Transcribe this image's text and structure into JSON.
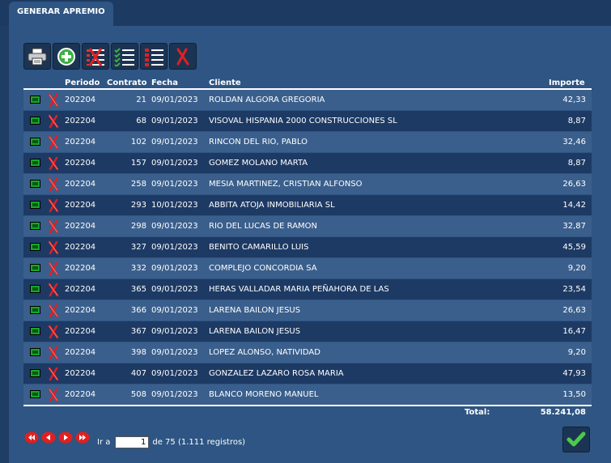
{
  "tab": {
    "title": "GENERAR APREMIO"
  },
  "toolbar": [
    {
      "icon": "printer-icon"
    },
    {
      "icon": "add-icon"
    },
    {
      "icon": "uncheck-all-icon"
    },
    {
      "icon": "check-list-icon"
    },
    {
      "icon": "numbered-list-icon"
    },
    {
      "icon": "delete-icon"
    }
  ],
  "table": {
    "headers": {
      "periodo": "Periodo",
      "contrato": "Contrato",
      "fecha": "Fecha",
      "cliente": "Cliente",
      "importe": "Importe"
    },
    "rows": [
      {
        "periodo": "202204",
        "contrato": "21",
        "fecha": "09/01/2023",
        "cliente": "ROLDAN ALGORA GREGORIA",
        "importe": "42,33"
      },
      {
        "periodo": "202204",
        "contrato": "68",
        "fecha": "09/01/2023",
        "cliente": "VISOVAL HISPANIA 2000 CONSTRUCCIONES SL",
        "importe": "8,87"
      },
      {
        "periodo": "202204",
        "contrato": "102",
        "fecha": "09/01/2023",
        "cliente": "RINCON DEL RIO, PABLO",
        "importe": "32,46"
      },
      {
        "periodo": "202204",
        "contrato": "157",
        "fecha": "09/01/2023",
        "cliente": "GOMEZ MOLANO MARTA",
        "importe": "8,87"
      },
      {
        "periodo": "202204",
        "contrato": "258",
        "fecha": "09/01/2023",
        "cliente": "MESIA MARTINEZ, CRISTIAN ALFONSO",
        "importe": "26,63"
      },
      {
        "periodo": "202204",
        "contrato": "293",
        "fecha": "10/01/2023",
        "cliente": "ABBITA ATOJA INMOBILIARIA SL",
        "importe": "14,42"
      },
      {
        "periodo": "202204",
        "contrato": "298",
        "fecha": "09/01/2023",
        "cliente": "RIO DEL LUCAS DE RAMON",
        "importe": "32,87"
      },
      {
        "periodo": "202204",
        "contrato": "327",
        "fecha": "09/01/2023",
        "cliente": "BENITO CAMARILLO LUIS",
        "importe": "45,59"
      },
      {
        "periodo": "202204",
        "contrato": "332",
        "fecha": "09/01/2023",
        "cliente": "COMPLEJO CONCORDIA SA",
        "importe": "9,20"
      },
      {
        "periodo": "202204",
        "contrato": "365",
        "fecha": "09/01/2023",
        "cliente": "HERAS VALLADAR MARIA PEÑAHORA DE LAS",
        "importe": "23,54"
      },
      {
        "periodo": "202204",
        "contrato": "366",
        "fecha": "09/01/2023",
        "cliente": "LARENA BAILON JESUS",
        "importe": "26,63"
      },
      {
        "periodo": "202204",
        "contrato": "367",
        "fecha": "09/01/2023",
        "cliente": "LARENA BAILON JESUS",
        "importe": "16,47"
      },
      {
        "periodo": "202204",
        "contrato": "398",
        "fecha": "09/01/2023",
        "cliente": "LOPEZ ALONSO, NATIVIDAD",
        "importe": "9,20"
      },
      {
        "periodo": "202204",
        "contrato": "407",
        "fecha": "09/01/2023",
        "cliente": "GONZALEZ LAZARO ROSA MARIA",
        "importe": "47,93"
      },
      {
        "periodo": "202204",
        "contrato": "508",
        "fecha": "09/01/2023",
        "cliente": "BLANCO MORENO MANUEL",
        "importe": "13,50"
      }
    ],
    "total_label": "Total:",
    "total_value": "58.241,08"
  },
  "pager": {
    "goto_label": "Ir a",
    "page_value": "1",
    "page_info": "de 75 (1.111 registros)"
  },
  "colors": {
    "background": "#1f3e66",
    "panel": "#2e5583",
    "row_odd": "#3a5f8c",
    "row_even": "#1d3a64"
  }
}
